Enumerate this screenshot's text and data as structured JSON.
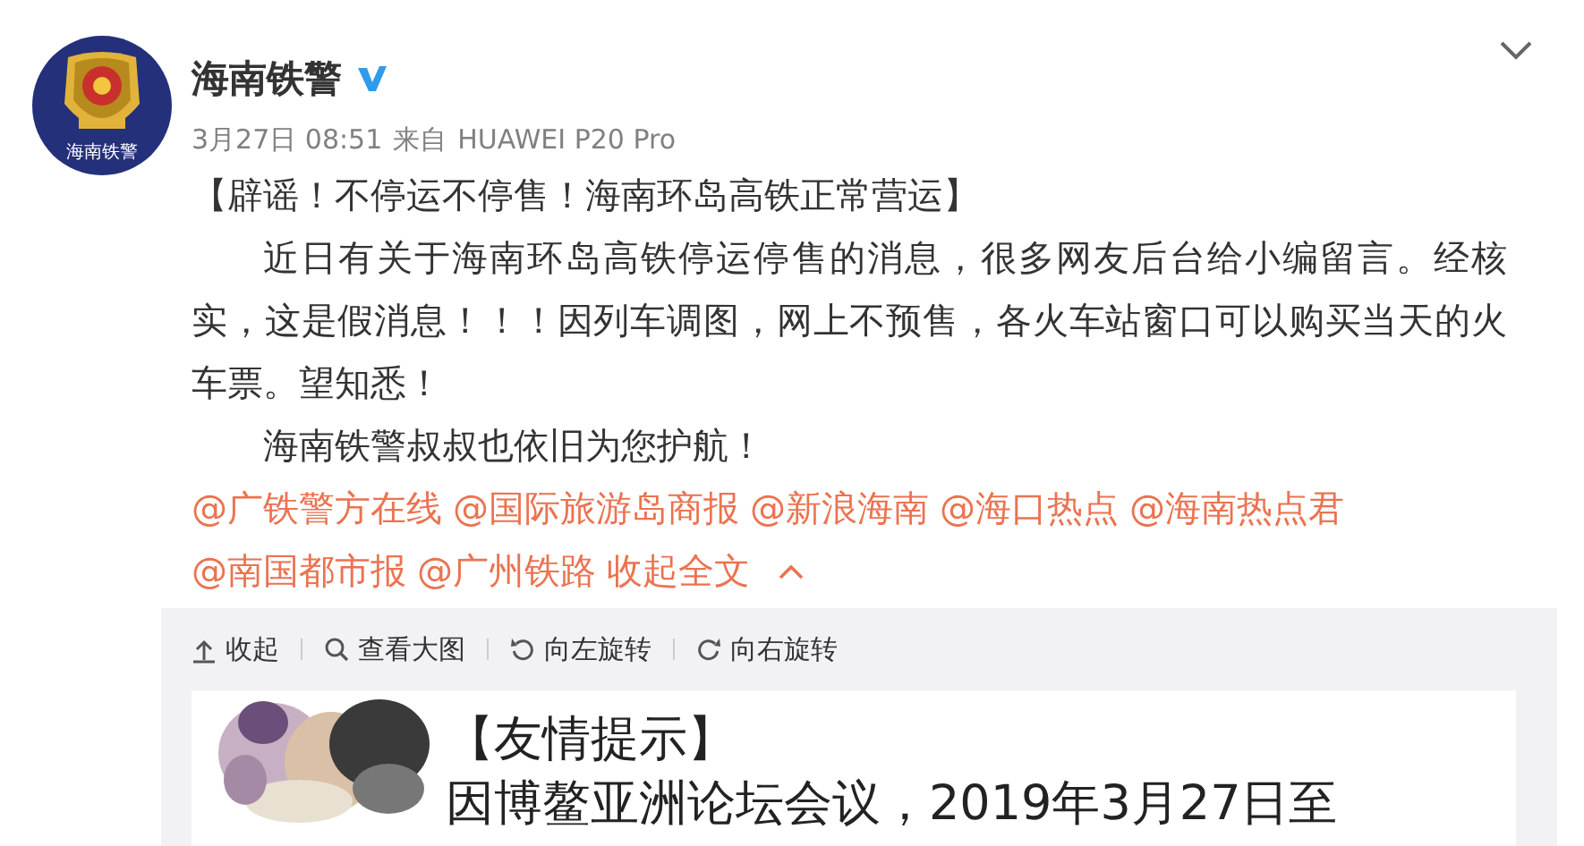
{
  "author": {
    "name": "海南铁警",
    "verified": true,
    "avatar_caption": "海南铁警"
  },
  "meta": {
    "time": "3月27日 08:51",
    "source_prefix": "来自",
    "source": "HUAWEI P20 Pro"
  },
  "post": {
    "title": "【辟谣！不停运不停售！海南环岛高铁正常营运】",
    "paragraphs": [
      "近日有关于海南环岛高铁停运停售的消息，很多网友后台给小编留言。经核实，这是假消息！！！因列车调图，网上不预售，各火车站窗口可以购买当天的火车票。望知悉！",
      "海南铁警叔叔也依旧为您护航！"
    ],
    "mentions": [
      "@广铁警方在线",
      "@国际旅游岛商报",
      "@新浪海南",
      "@海口热点",
      "@海南热点君",
      "@南国都市报",
      "@广州铁路"
    ],
    "collapse_link": "收起全文"
  },
  "media_toolbar": [
    {
      "kind": "collapse",
      "label": "收起"
    },
    {
      "kind": "zoom",
      "label": "查看大图"
    },
    {
      "kind": "rotate_left",
      "label": "向左旋转"
    },
    {
      "kind": "rotate_right",
      "label": "向右旋转"
    }
  ],
  "image": {
    "kind": "picture",
    "lines": [
      "【友情提示】",
      "因博鳌亚洲论坛会议，2019年3月27日至"
    ]
  }
}
